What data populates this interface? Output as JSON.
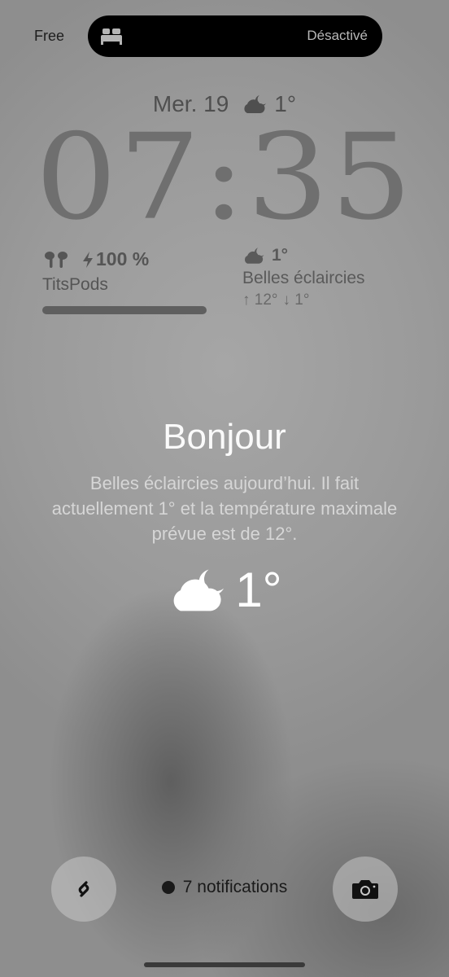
{
  "status_bar": {
    "carrier": "Free"
  },
  "dynamic_island": {
    "icon": "bed-icon",
    "status": "Désactivé"
  },
  "lock_screen": {
    "date": "Mer. 19",
    "date_weather_temp": "1°",
    "time": "07:35"
  },
  "widgets": {
    "airpods": {
      "icon": "airpods-icon",
      "battery": "100 %",
      "name": "TitsPods",
      "battery_level": 1.0
    },
    "weather": {
      "icon": "partly-cloudy-night-icon",
      "temp": "1°",
      "condition": "Belles éclaircies",
      "high": "12°",
      "low": "1°"
    }
  },
  "greeting": {
    "title": "Bonjour",
    "summary": "Belles éclaircies aujourd’hui. Il fait actuellement 1° et la température maximale prévue est de 12°.",
    "temp": "1°"
  },
  "bottom": {
    "notifications": "7 notifications",
    "left_button_icon": "shazam-icon",
    "right_button_icon": "camera-icon"
  },
  "colors": {
    "background": "#9a9a9a",
    "island": "#000000",
    "greeting_text": "#fafafa"
  }
}
